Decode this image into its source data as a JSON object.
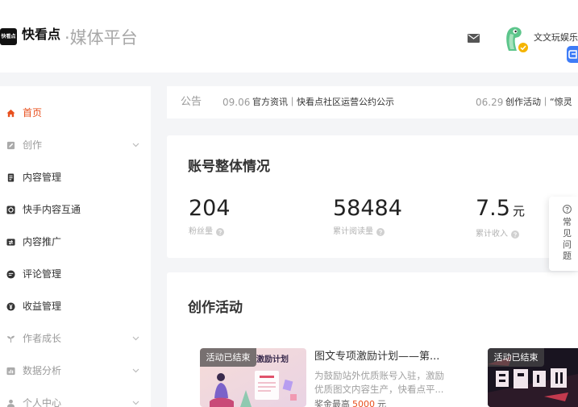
{
  "header": {
    "logo_badge_text": "快看点",
    "logo_text": "快看点",
    "platform_name": "·媒体平台",
    "user_name": "文文玩娱乐",
    "icons": [
      "mail-icon",
      "avatar",
      "verified-badge-icon",
      "assistant-icon"
    ]
  },
  "sidebar": {
    "items": [
      {
        "label": "首页",
        "icon": "home-icon",
        "active": true
      },
      {
        "label": "创作",
        "icon": "edit-icon",
        "expandable": true
      },
      {
        "label": "内容管理",
        "icon": "document-icon"
      },
      {
        "label": "快手内容互通",
        "icon": "sync-icon"
      },
      {
        "label": "内容推广",
        "icon": "promote-icon"
      },
      {
        "label": "评论管理",
        "icon": "comment-icon"
      },
      {
        "label": "收益管理",
        "icon": "income-icon"
      },
      {
        "label": "作者成长",
        "icon": "sprout-icon",
        "expandable": true
      },
      {
        "label": "数据分析",
        "icon": "chart-icon",
        "expandable": true
      },
      {
        "label": "个人中心",
        "icon": "user-icon",
        "expandable": true
      }
    ]
  },
  "notice": {
    "label": "公告",
    "items": [
      {
        "date": "09.06",
        "text": "官方资讯｜快看点社区运营公约公示"
      },
      {
        "date": "06.29",
        "text": "创作活动｜“惊灵"
      }
    ]
  },
  "account_overview": {
    "title": "账号整体情况",
    "stats": [
      {
        "value": "204",
        "label": "粉丝量"
      },
      {
        "value": "58484",
        "label": "累计阅读量"
      },
      {
        "value": "7.5",
        "unit": "元",
        "label": "累计收入"
      }
    ]
  },
  "help": {
    "label": "常见问题",
    "icon": "question-icon"
  },
  "activities": {
    "title": "创作活动",
    "items": [
      {
        "status": "活动已结束",
        "poster_text": "激励计划",
        "title": "图文专项激励计划——第...",
        "description": "为鼓励站外优质账号入驻，激励优质图文内容生产，快看点平...",
        "prize_label": "奖金最高",
        "prize_amount": "5000",
        "prize_unit": "元"
      },
      {
        "status": "活动已结束"
      }
    ]
  },
  "colors": {
    "accent": "#e8501e",
    "brand_blue": "#3e7cf7",
    "background": "#f4f5f7"
  }
}
